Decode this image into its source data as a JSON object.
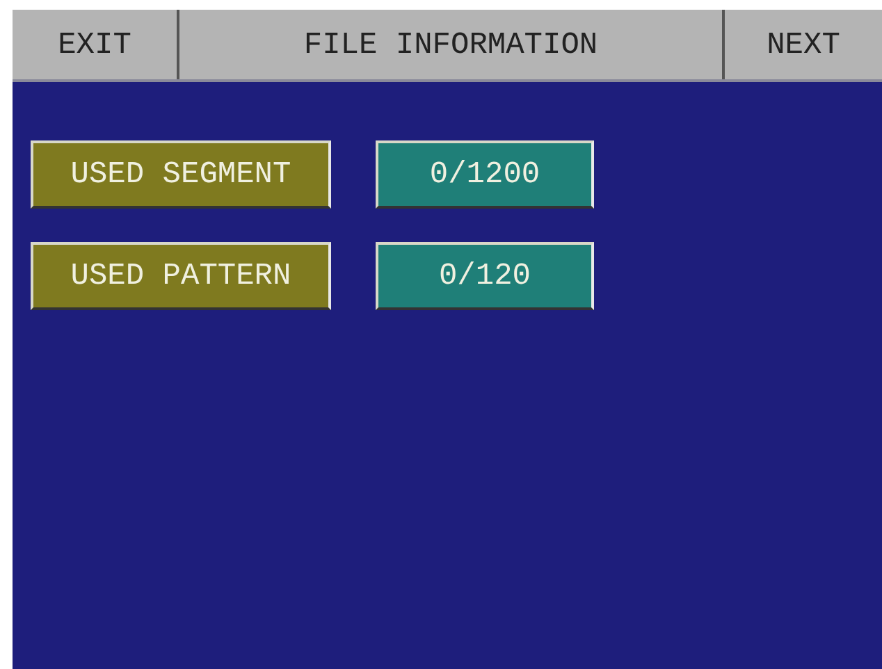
{
  "header": {
    "left_button": "EXIT",
    "title": "FILE INFORMATION",
    "right_button": "NEXT"
  },
  "rows": [
    {
      "label": "USED SEGMENT",
      "value": "0/1200"
    },
    {
      "label": "USED PATTERN",
      "value": "0/120"
    }
  ]
}
